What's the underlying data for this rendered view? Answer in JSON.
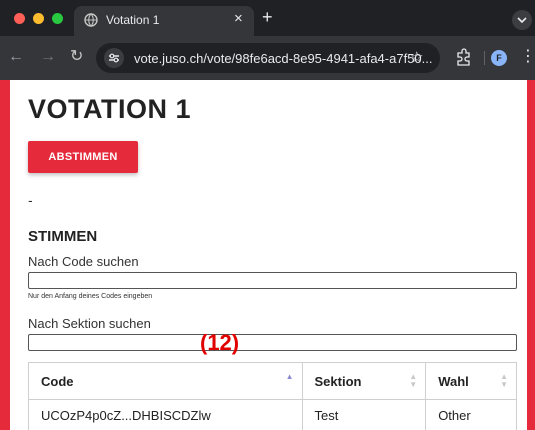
{
  "browser": {
    "tab_title": "Votation 1",
    "tab_close": "×",
    "new_tab": "+",
    "url": "vote.juso.ch/vote/98fe6acd-8e95-4941-afa4-a7f50...",
    "profile_initial": "F",
    "icons": [
      "globe-icon",
      "back-arrow-icon",
      "forward-arrow-icon",
      "reload-icon",
      "site-info-icon",
      "star-icon",
      "extensions-icon",
      "kebab-menu-icon",
      "chevron-down-icon"
    ]
  },
  "page": {
    "title": "VOTATION 1",
    "vote_button": "ABSTIMMEN",
    "description": "-",
    "votes_heading": "STIMMEN",
    "code_search_label": "Nach Code suchen",
    "code_search_value": "",
    "code_hint": "Nur den Anfang deines Codes eingeben",
    "section_search_label": "Nach Sektion suchen",
    "section_search_value": "",
    "accent_color": "#e52a3b"
  },
  "table": {
    "headers": [
      "Code",
      "Sektion",
      "Wahl"
    ],
    "sort_column": "Code",
    "sort_direction": "ascending",
    "rows": [
      [
        "UCOzP4p0cZ...DHBISCDZlw",
        "Test",
        "Other"
      ]
    ]
  },
  "overlay": {
    "count_label": "(12)"
  }
}
